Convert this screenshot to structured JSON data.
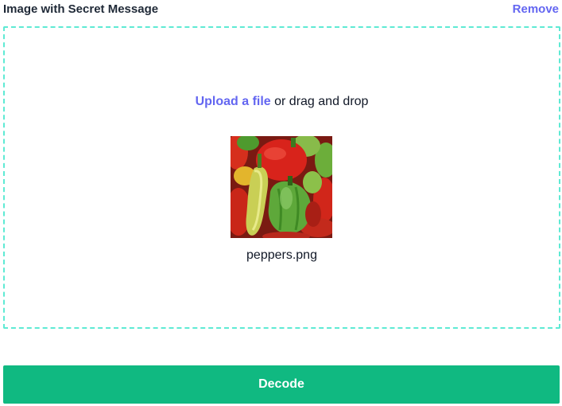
{
  "header": {
    "title": "Image with Secret Message",
    "remove_label": "Remove"
  },
  "dropzone": {
    "upload_link": "Upload a file",
    "upload_rest": " or drag and drop",
    "file_name": "peppers.png"
  },
  "actions": {
    "decode_label": "Decode"
  },
  "colors": {
    "accent": "#6366f1",
    "dropzone_border": "#5eead4",
    "decode_button": "#10b981"
  }
}
